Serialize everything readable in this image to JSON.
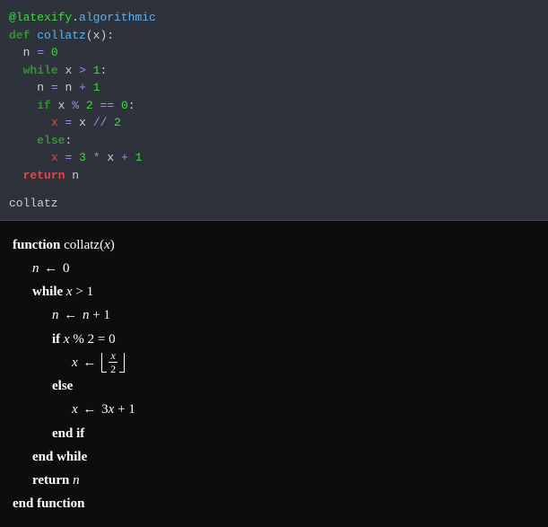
{
  "code": {
    "decorator_at": "@",
    "decorator_module": "latexify",
    "decorator_dot": ".",
    "decorator_attr": "algorithmic",
    "def_kw": "def",
    "func_name": "collatz",
    "param": "x",
    "colon": ":",
    "n_var": "n",
    "eq": "=",
    "zero": "0",
    "while_kw": "while",
    "x_var": "x",
    "gt": ">",
    "one": "1",
    "plus": "+",
    "if_kw": "if",
    "mod": "%",
    "two": "2",
    "eqeq": "==",
    "floordiv": "//",
    "else_kw": "else",
    "three": "3",
    "star": "*",
    "return_kw": "return",
    "output": "collatz"
  },
  "pseudo": {
    "function_kw": "function",
    "func_name": "collatz",
    "open_paren": "(",
    "x": "x",
    "close_paren": ")",
    "n": "n",
    "arrow": "←",
    "zero": "0",
    "while_kw": "while",
    "gt": ">",
    "one": "1",
    "plus": "+",
    "if_kw": "if",
    "mod_op": "%",
    "two": "2",
    "eq": "=",
    "else_kw": "else",
    "three": "3",
    "endif": "end if",
    "endwhile": "end while",
    "return_kw": "return",
    "endfunction": "end function"
  }
}
